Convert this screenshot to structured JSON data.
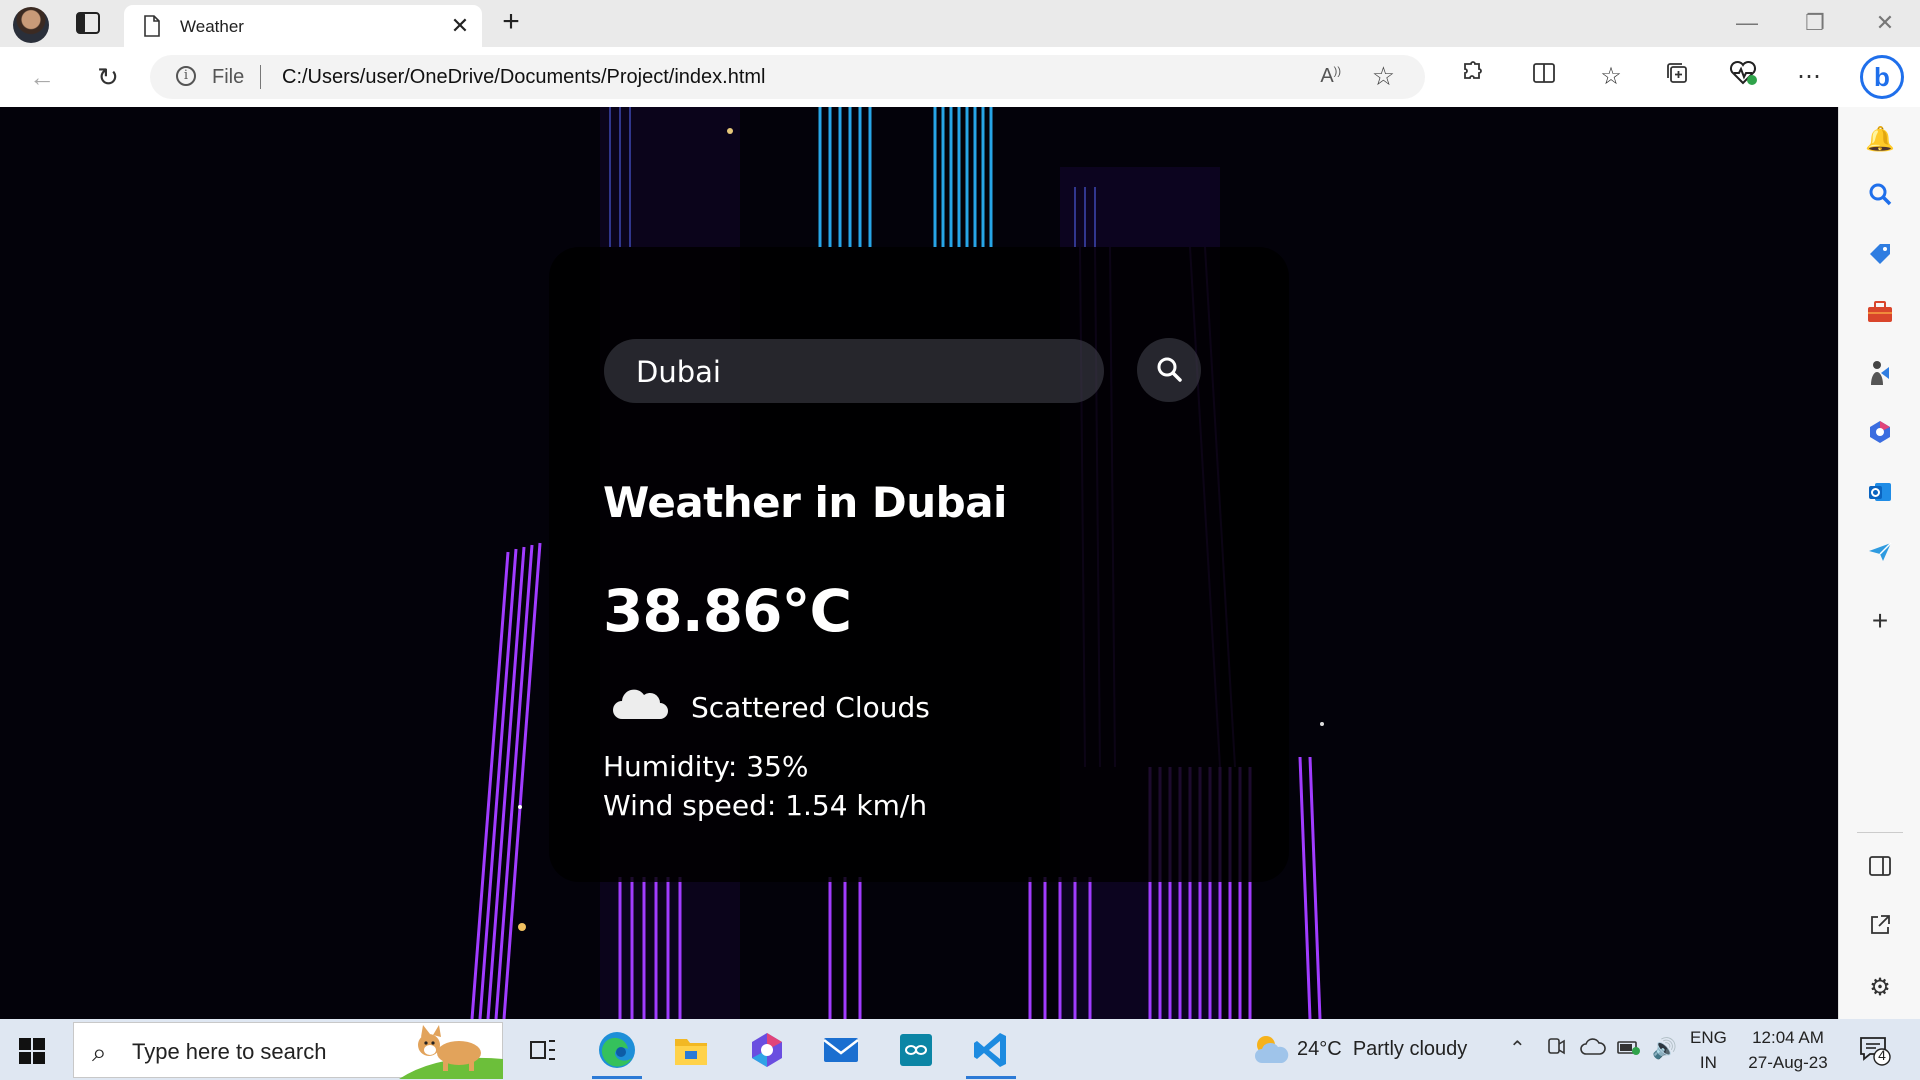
{
  "browser": {
    "tab": {
      "title": "Weather"
    },
    "address": {
      "scheme": "File",
      "url": "C:/Users/user/OneDrive/Documents/Project/index.html"
    }
  },
  "weather": {
    "search_value": "Dubai",
    "city_heading": "Weather in Dubai",
    "temperature": "38.86°C",
    "description": "Scattered Clouds",
    "humidity": "Humidity: 35%",
    "wind": "Wind speed: 1.54 km/h",
    "condition_icon": "cloud-icon"
  },
  "taskbar": {
    "search_placeholder": "Type here to search",
    "weather_widget": {
      "temp": "24°C",
      "condition": "Partly cloudy"
    },
    "language": {
      "line1": "ENG",
      "line2": "IN"
    },
    "clock": {
      "time": "12:04 AM",
      "date": "27-Aug-23"
    },
    "notification_count": "4"
  },
  "colors": {
    "accent": "#1f6feb",
    "beam_purple": "#a13cff",
    "beam_blue": "#2bb7ff"
  }
}
